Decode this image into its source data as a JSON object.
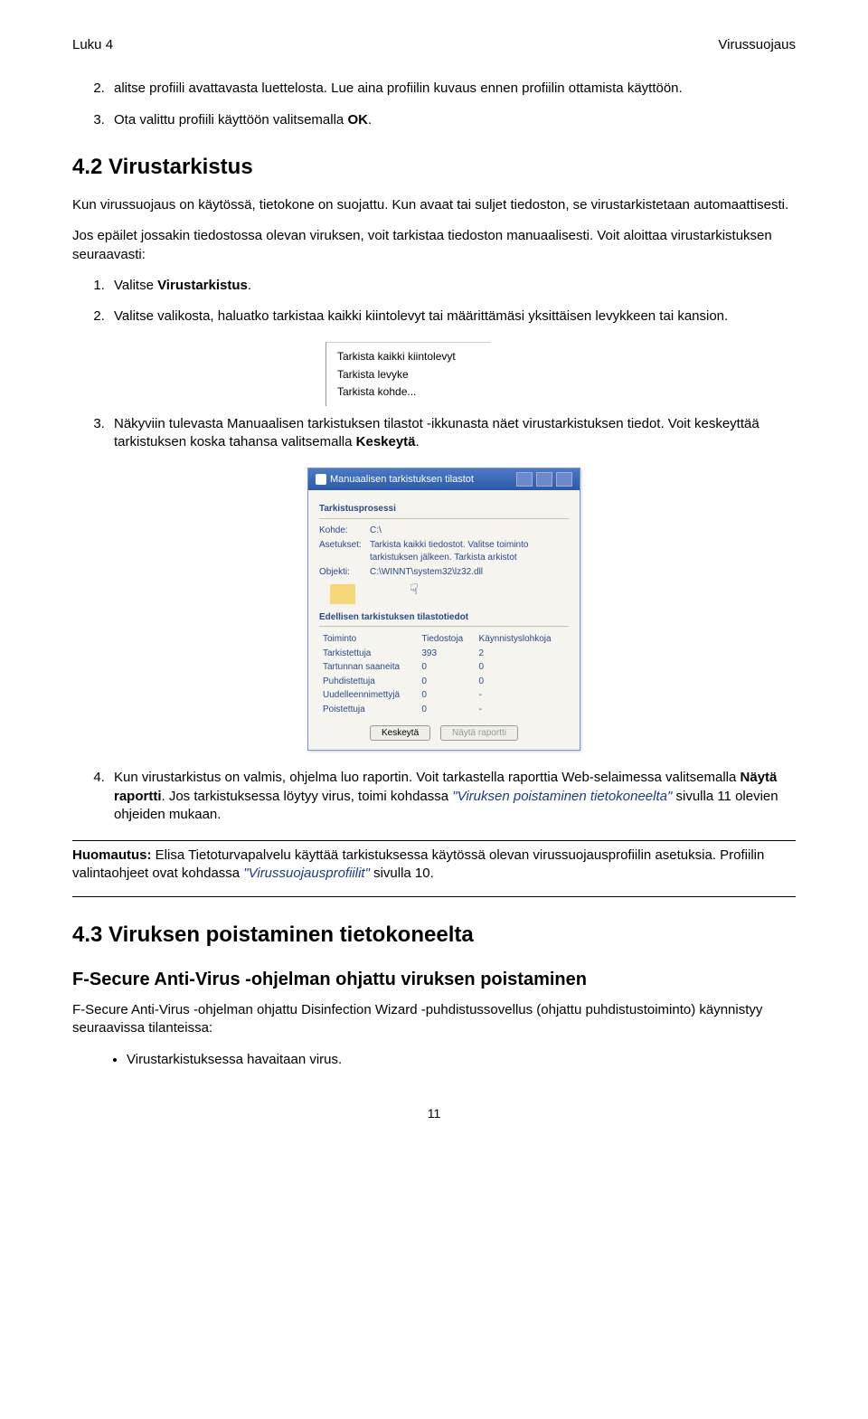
{
  "header": {
    "left": "Luku 4",
    "right": "Virussuojaus"
  },
  "list1": {
    "item2": "alitse profiili avattavasta luettelosta. Lue aina profiilin kuvaus ennen profiilin ottamista käyttöön.",
    "item3_a": "Ota valittu profiili käyttöön valitsemalla ",
    "item3_b": "OK",
    "item3_c": "."
  },
  "h2_42": "4.2 Virustarkistus",
  "p1": "Kun virussuojaus on käytössä, tietokone on suojattu. Kun avaat tai suljet tiedoston, se virustarkistetaan automaattisesti.",
  "p2": "Jos epäilet jossakin tiedostossa olevan viruksen, voit tarkistaa tiedoston manuaalisesti. Voit aloittaa virustarkistuksen seuraavasti:",
  "list2": {
    "item1_a": "Valitse ",
    "item1_b": "Virustarkistus",
    "item1_c": ".",
    "item2": "Valitse valikosta, haluatko tarkistaa kaikki kiintolevyt tai määrittämäsi yksittäisen levykkeen tai kansion.",
    "item3_a": "Näkyviin tulevasta Manuaalisen tarkistuksen tilastot -ikkunasta näet virustarkistuksen tiedot. Voit keskeyttää tarkistuksen koska tahansa valitsemalla ",
    "item3_b": "Keskeytä",
    "item3_c": ".",
    "item4_a": "Kun virustarkistus on valmis, ohjelma luo raportin. Voit tarkastella raporttia Web-selaimessa valitsemalla ",
    "item4_b": "Näytä raportti",
    "item4_c": ". Jos tarkistuksessa löytyy virus, toimi kohdassa ",
    "item4_link": "\"Viruksen poistaminen tietokoneelta\"",
    "item4_d": " sivulla 11 olevien ohjeiden mukaan."
  },
  "menu": {
    "opt1": "Tarkista kaikki kiintolevyt",
    "opt2": "Tarkista levyke",
    "opt3": "Tarkista kohde..."
  },
  "dialog": {
    "title": "Manuaalisen tarkistuksen tilastot",
    "sec1": "Tarkistusprosessi",
    "kohde_lbl": "Kohde:",
    "kohde_val": "C:\\",
    "aset_lbl": "Asetukset:",
    "aset_val": "Tarkista kaikki tiedostot. Valitse toiminto tarkistuksen jälkeen. Tarkista arkistot",
    "obj_lbl": "Objekti:",
    "obj_val": "C:\\WINNT\\system32\\lz32.dll",
    "sec2": "Edellisen tarkistuksen tilastotiedot",
    "th1": "Toiminto",
    "th2": "Tiedostoja",
    "th3": "Käynnistyslohkoja",
    "r1a": "Tarkistettuja",
    "r1b": "393",
    "r1c": "2",
    "r2a": "Tartunnan saaneita",
    "r2b": "0",
    "r2c": "0",
    "r3a": "Puhdistettuja",
    "r3b": "0",
    "r3c": "0",
    "r4a": "Uudelleennimettyjä",
    "r4b": "0",
    "r4c": "-",
    "r5a": "Poistettuja",
    "r5b": "0",
    "r5c": "-",
    "btn1": "Keskeytä",
    "btn2": "Näytä raportti"
  },
  "note": {
    "a": "Huomautus:",
    "b": " Elisa Tietoturvapalvelu käyttää tarkistuksessa käytössä olevan virussuojausprofiilin asetuksia. Profiilin valintaohjeet ovat kohdassa ",
    "link": "\"Virussuojausprofiilit\"",
    "c": " sivulla 10."
  },
  "h2_43": "4.3 Viruksen poistaminen tietokoneelta",
  "h3": "F-Secure Anti-Virus -ohjelman ohjattu viruksen poistaminen",
  "p3": "F-Secure Anti-Virus -ohjelman ohjattu Disinfection Wizard -puhdistussovellus (ohjattu puhdistustoiminto) käynnistyy seuraavissa tilanteissa:",
  "bullet1": "Virustarkistuksessa havaitaan virus.",
  "page_number": "11"
}
